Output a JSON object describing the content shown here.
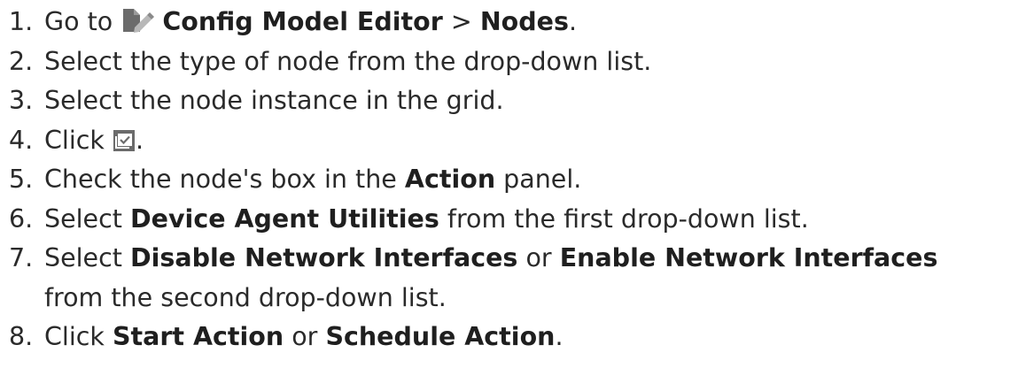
{
  "steps": [
    {
      "num": "1.",
      "t1": "Go to ",
      "icon": "config-model-editor-icon",
      "b1": "Config Model Editor",
      "t2": " > ",
      "b2": "Nodes",
      "t3": "."
    },
    {
      "num": "2.",
      "text": "Select the type of node from the drop-down list."
    },
    {
      "num": "3.",
      "text": "Select the node instance in the grid."
    },
    {
      "num": "4.",
      "t1": "Click ",
      "icon": "select-action-icon",
      "t2": "."
    },
    {
      "num": "5.",
      "t1": "Check the node's box in the ",
      "b1": "Action",
      "t2": " panel."
    },
    {
      "num": "6.",
      "t1": "Select ",
      "b1": "Device Agent Utilities",
      "t2": " from the first drop-down list."
    },
    {
      "num": "7.",
      "t1": "Select ",
      "b1": "Disable Network Interfaces",
      "t2": " or ",
      "b2": "Enable Network Interfaces",
      "t3": "from the second drop-down list."
    },
    {
      "num": "8.",
      "t1": "Click ",
      "b1": "Start Action",
      "t2": " or ",
      "b2": "Schedule Action",
      "t3": "."
    }
  ],
  "colors": {
    "text": "#2a2a2a",
    "icon_fill": "#6b6b6b",
    "icon_accent": "#b8b8b8"
  }
}
